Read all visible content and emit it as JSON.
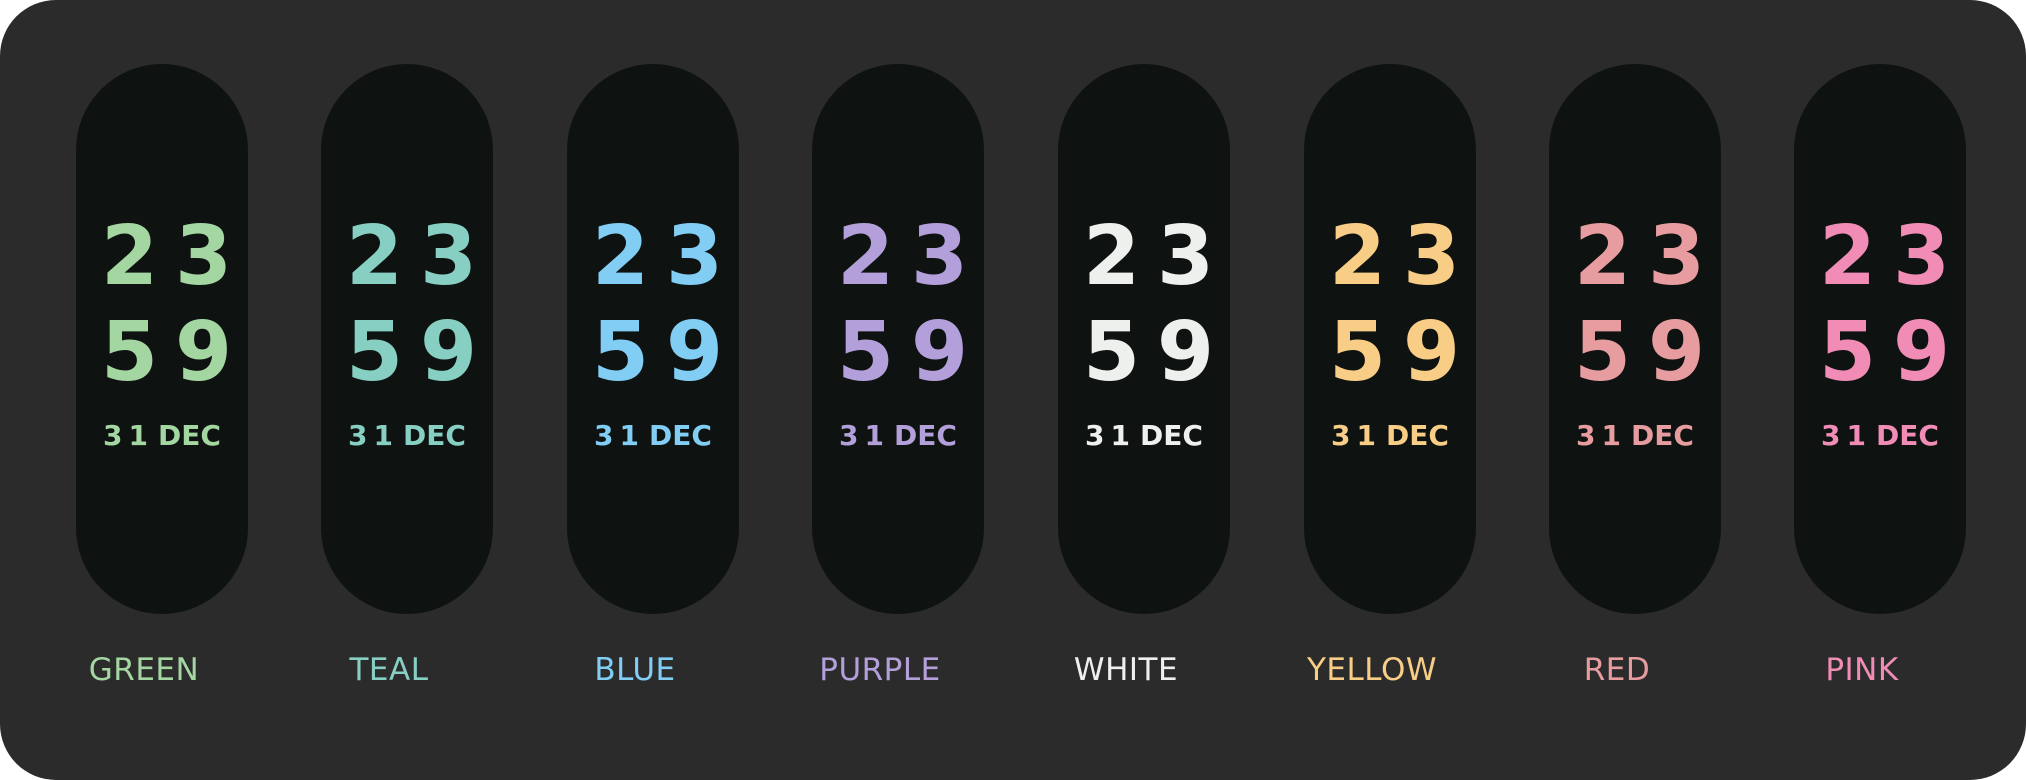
{
  "clock": {
    "hour_tens": "2",
    "hour_ones": "3",
    "minute_tens": "5",
    "minute_ones": "9",
    "day": "31",
    "month": "DEC"
  },
  "themes": [
    {
      "name": "GREEN",
      "color": "#a4d6a2"
    },
    {
      "name": "TEAL",
      "color": "#86cfc2"
    },
    {
      "name": "BLUE",
      "color": "#82cdf4"
    },
    {
      "name": "PURPLE",
      "color": "#b3a0db"
    },
    {
      "name": "WHITE",
      "color": "#eef0ee"
    },
    {
      "name": "YELLOW",
      "color": "#f8cd86"
    },
    {
      "name": "RED",
      "color": "#e79da0"
    },
    {
      "name": "PINK",
      "color": "#f08cb6"
    }
  ]
}
